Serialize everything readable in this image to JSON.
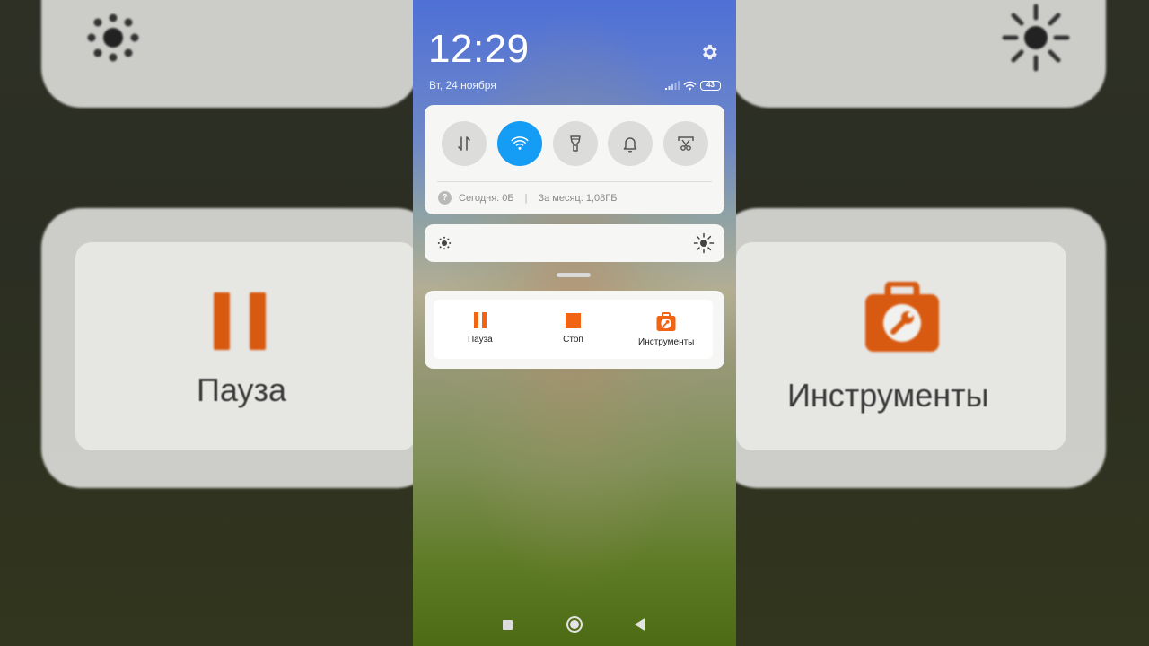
{
  "background": {
    "pause_label": "Пауза",
    "tools_label": "Инструменты"
  },
  "status_bar": {
    "time": "12:29",
    "date": "Вт, 24 ноября",
    "battery_level": "43",
    "icons": [
      "signal-icon",
      "wifi-icon",
      "battery-icon"
    ]
  },
  "settings_icon": "gear-icon",
  "quick_settings": {
    "toggles": [
      {
        "name": "mobile-data",
        "icon": "data-arrows-icon",
        "active": false
      },
      {
        "name": "wifi",
        "icon": "wifi-icon",
        "active": true
      },
      {
        "name": "flashlight",
        "icon": "flashlight-icon",
        "active": false
      },
      {
        "name": "sound",
        "icon": "bell-icon",
        "active": false
      },
      {
        "name": "screenshot",
        "icon": "screenshot-scissors-icon",
        "active": false
      }
    ],
    "usage_today": "Сегодня: 0Б",
    "usage_separator": "|",
    "usage_month": "За месяц: 1,08ГБ",
    "help_symbol": "?"
  },
  "brightness": {
    "low_icon": "brightness-low-icon",
    "high_icon": "brightness-high-icon"
  },
  "notification": {
    "actions": [
      {
        "label": "Пауза",
        "icon": "pause-icon"
      },
      {
        "label": "Стоп",
        "icon": "stop-icon"
      },
      {
        "label": "Инструменты",
        "icon": "toolbox-icon"
      }
    ]
  },
  "navigation": [
    "recents-button",
    "home-button",
    "back-button"
  ],
  "colors": {
    "accent_blue": "#159cf5",
    "accent_orange": "#f06414",
    "card_bg": "#f6f6f4"
  }
}
